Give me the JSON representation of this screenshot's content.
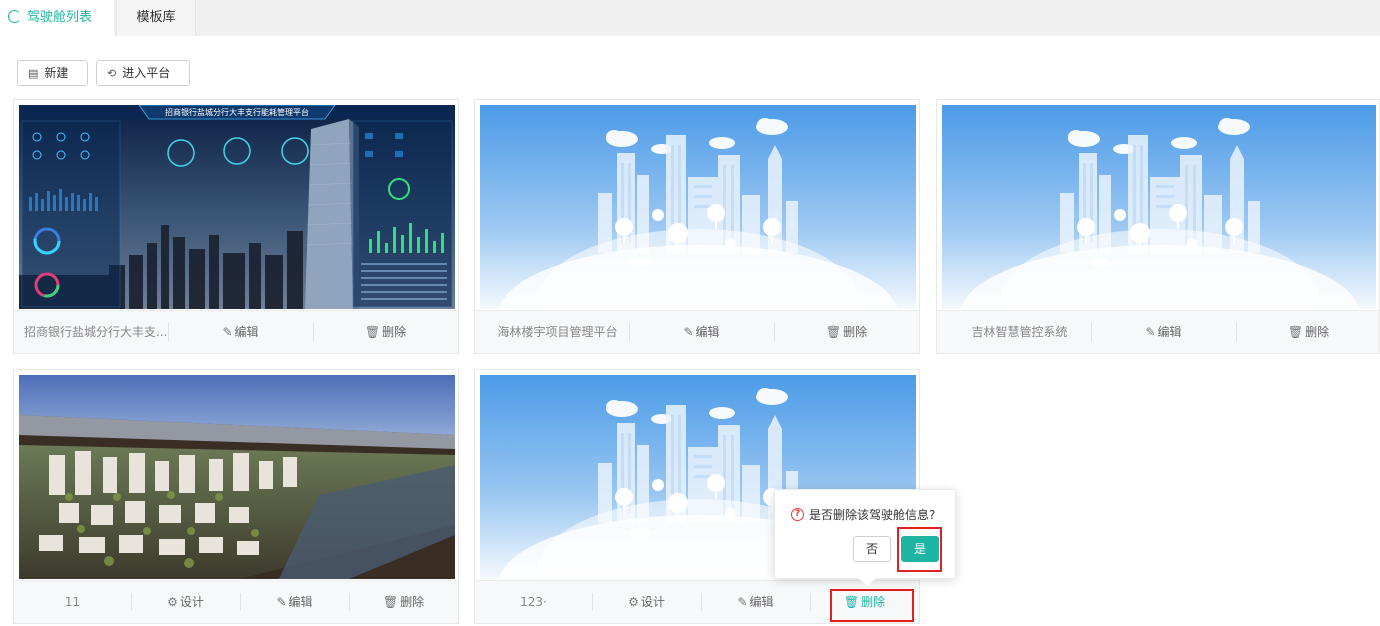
{
  "tabs": [
    {
      "label": "驾驶舱列表",
      "active": true
    },
    {
      "label": "模板库",
      "active": false
    }
  ],
  "toolbar": {
    "new_label": "新建",
    "enter_label": "进入平台"
  },
  "cards": [
    {
      "name": "招商银行盐城分行大丰支...",
      "edit": "编辑",
      "delete": "删除",
      "thumbnail": "dashboard"
    },
    {
      "name": "海林楼宇项目管理平台",
      "edit": "编辑",
      "delete": "删除",
      "thumbnail": "city"
    },
    {
      "name": "吉林智慧管控系统",
      "edit": "编辑",
      "delete": "删除",
      "thumbnail": "city"
    },
    {
      "name": "11",
      "design": "设计",
      "edit": "编辑",
      "delete": "删除",
      "thumbnail": "model"
    },
    {
      "name": "123·",
      "design": "设计",
      "edit": "编辑",
      "delete": "删除",
      "thumbnail": "city"
    }
  ],
  "dashboard_title": "招商银行盐城分行大丰支行能耗管理平台",
  "popconfirm": {
    "message": "是否删除该驾驶舱信息?",
    "cancel": "否",
    "confirm": "是"
  },
  "colors": {
    "accent": "#1fb5a3",
    "highlight": "#e0211f",
    "danger_icon": "#e53935"
  }
}
